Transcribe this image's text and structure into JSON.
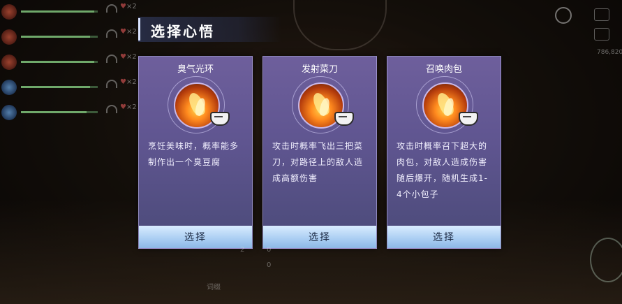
{
  "party": [
    {
      "name": "",
      "hp": 0.95,
      "avatar": "red",
      "heart_count": "×2"
    },
    {
      "name": "",
      "hp": 0.9,
      "avatar": "red",
      "heart_count": "×2"
    },
    {
      "name": "",
      "hp": 0.95,
      "avatar": "red",
      "heart_count": "×2"
    },
    {
      "name": "",
      "hp": 0.9,
      "avatar": "blue",
      "heart_count": "×2"
    },
    {
      "name": "",
      "hp": 0.85,
      "avatar": "blue",
      "heart_count": "×2"
    }
  ],
  "title": "选择心悟",
  "npc_tag": "",
  "coords": "786,820",
  "cards": [
    {
      "name": "臭气光环",
      "desc": "烹饪美味时，概率能多制作出一个臭豆腐",
      "button": "选择"
    },
    {
      "name": "发射菜刀",
      "desc": "攻击时概率飞出三把菜刀，对路径上的敌人造成高额伤害",
      "button": "选择"
    },
    {
      "name": "召唤肉包",
      "desc": "攻击时概率召下超大的肉包，对敌人造成伤害随后爆开，随机生成1-4个小包子",
      "button": "选择"
    }
  ],
  "bottom": {
    "stat_a_label": "",
    "stat_a_value": "2",
    "stat_b_value": "0",
    "stat_c_value": "0",
    "ingredient_label": "词缀",
    "chat": "",
    "colors": {
      "card_top": "#6e5f9c",
      "card_bottom": "#4a4a78",
      "button": "#a9cdf2"
    }
  }
}
